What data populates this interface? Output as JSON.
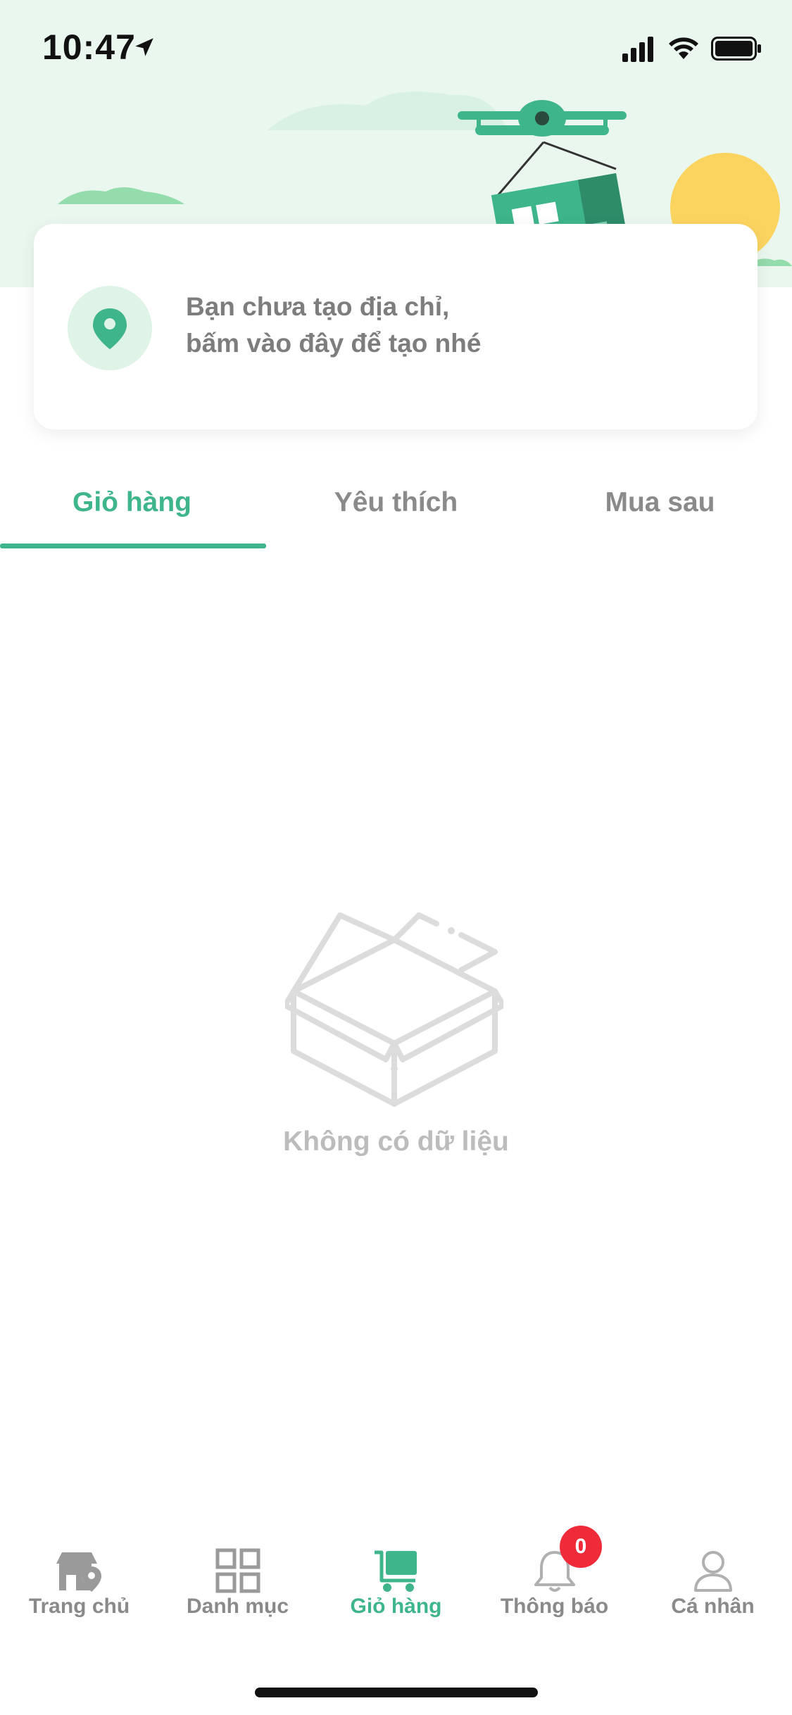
{
  "status_bar": {
    "time": "10:47"
  },
  "address_card": {
    "line1": "Bạn chưa tạo địa chỉ,",
    "line2": "bấm vào đây để tạo nhé"
  },
  "tabs": [
    {
      "label": "Giỏ hàng",
      "active": true
    },
    {
      "label": "Yêu thích",
      "active": false
    },
    {
      "label": "Mua sau",
      "active": false
    }
  ],
  "empty_state": {
    "message": "Không có dữ liệu"
  },
  "bottom_nav": {
    "items": [
      {
        "label": "Trang chủ",
        "icon": "home-store-icon"
      },
      {
        "label": "Danh mục",
        "icon": "grid-icon"
      },
      {
        "label": "Giỏ hàng",
        "icon": "cart-icon",
        "active": true
      },
      {
        "label": "Thông báo",
        "icon": "bell-icon",
        "badge": "0"
      },
      {
        "label": "Cá nhân",
        "icon": "user-icon"
      }
    ]
  },
  "colors": {
    "accent": "#3fb58b",
    "header_bg": "#eaf7ef",
    "badge": "#ef2b3a",
    "muted_text": "#8a8a8a",
    "empty_text": "#bcbcbc"
  }
}
